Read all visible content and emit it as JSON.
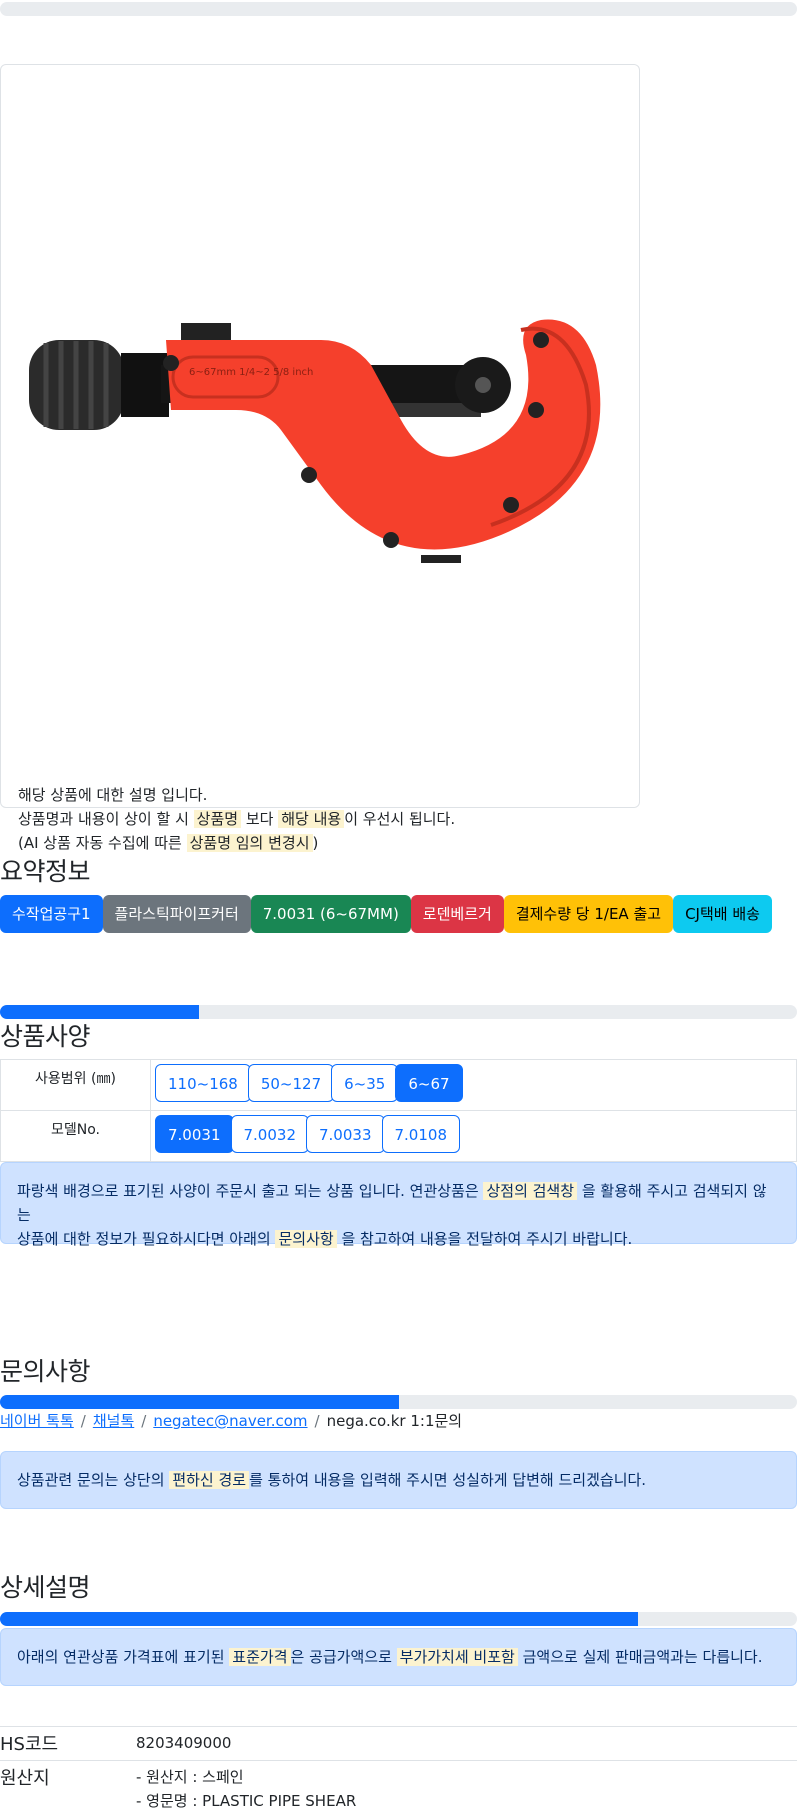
{
  "product": {
    "description_lines": [
      "해당 상품에 대한 설명 입니다.",
      "상품명과 내용이 상이 할 시",
      "상품명",
      "보다",
      "해당 내용",
      "이 우선시 됩니다.",
      "(AI 상품 자동 수집에 따른",
      "상품명 임의 변경시",
      ")"
    ],
    "image_label": "6~67mm 1/4~2 5/8 inch"
  },
  "summary": {
    "title": "요약정보",
    "badges": [
      {
        "label": "수작업공구1",
        "bg": "#0d6efd",
        "color": "#ffffff"
      },
      {
        "label": "플라스틱파이프커터",
        "bg": "#6c757d",
        "color": "#ffffff"
      },
      {
        "label": "7.0031 (6~67MM)",
        "bg": "#198754",
        "color": "#ffffff"
      },
      {
        "label": "로덴베르거",
        "bg": "#dc3545",
        "color": "#ffffff"
      },
      {
        "label": "결제수량 당 1/EA 출고",
        "bg": "#ffc107",
        "color": "#000000"
      },
      {
        "label": "CJ택배 배송",
        "bg": "#0dcaf0",
        "color": "#000000"
      }
    ]
  },
  "spec": {
    "title": "상품사양",
    "progress": 0.25,
    "rows": [
      {
        "label": "사용범위 (㎜)",
        "options": [
          "110~168",
          "50~127",
          "6~35",
          "6~67"
        ],
        "selected": 3
      },
      {
        "label": "모델No.",
        "options": [
          "7.0031",
          "7.0032",
          "7.0033",
          "7.0108"
        ],
        "selected": 0
      }
    ],
    "notice": {
      "p1": "파랑색 배경으로 표기된 사양이 주문시 출고 되는 상품 입니다. 연관상품은",
      "m1": "상점의 검색창",
      "p2": "을 활용해 주시고 검색되지 않는",
      "p3": "상품에 대한 정보가 필요하시다면 아래의",
      "m2": "문의사항",
      "p4": "을 참고하여 내용을 전달하여 주시기 바랍니다."
    }
  },
  "inquiry": {
    "title": "문의사항",
    "progress": 0.5,
    "links": [
      "네이버 톡톡",
      "채널톡",
      "negatec@naver.com"
    ],
    "plain_link": "nega.co.kr 1:1문의",
    "notice": {
      "p1": "상품관련 문의는 상단의",
      "m1": "편하신 경로",
      "p2": "를 통하여 내용을 입력해 주시면 성실하게 답변해 드리겠습니다."
    }
  },
  "detail": {
    "title": "상세설명",
    "progress": 0.8,
    "notice": {
      "p1": "아래의 연관상품 가격표에 표기된",
      "m1": "표준가격",
      "p2": "은 공급가액으로",
      "m2": "부가가치세 비포함",
      "p3": "금액으로 실제 판매금액과는 다릅니다."
    },
    "hs_label": "HS코드",
    "hs_value": "8203409000",
    "origin_label": "원산지",
    "origin_lines": [
      "- 원산지 : 스페인",
      "- 영문명 : PLASTIC PIPE SHEAR"
    ]
  },
  "colors": {
    "primary": "#0d6efd",
    "info_bg": "#cfe2ff",
    "highlight": "#fcf3cf",
    "tool_orange": "#f5402c"
  }
}
